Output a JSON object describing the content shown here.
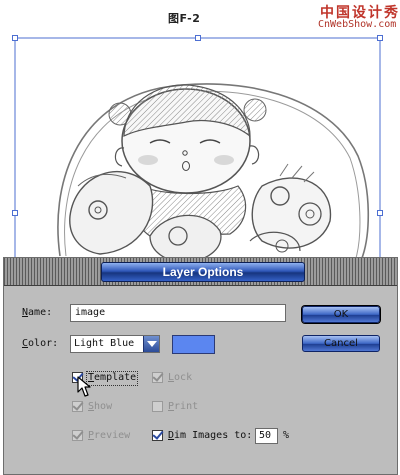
{
  "figure_caption": "图F-2",
  "watermark": {
    "cn": "中国设计秀",
    "en": "CnWebShow.com"
  },
  "dialog": {
    "title": "Layer Options",
    "name_label_first": "N",
    "name_label_rest": "ame:",
    "name_value": "image",
    "color_label_first": "C",
    "color_label_rest": "olor:",
    "color_value": "Light Blue",
    "swatch_color": "#5b86f0",
    "ok_label": "OK",
    "cancel_label": "Cancel",
    "options": {
      "template": {
        "label_first": "T",
        "label_rest": "emplate",
        "checked": true,
        "enabled": true
      },
      "lock": {
        "label_first": "L",
        "label_rest": "ock",
        "checked": true,
        "enabled": false
      },
      "show": {
        "label_first": "S",
        "label_rest": "how",
        "checked": true,
        "enabled": false
      },
      "print": {
        "label_first": "P",
        "label_rest": "rint",
        "checked": false,
        "enabled": false
      },
      "preview": {
        "label_first": "P",
        "label_rest": "review",
        "checked": true,
        "enabled": false
      },
      "dim_images": {
        "label_first": "D",
        "label_rest": "im Images to:",
        "checked": true,
        "enabled": true,
        "value": "50",
        "unit": "%"
      }
    }
  },
  "colors": {
    "title_blue": "#2f57b9",
    "dialog_gray": "#bdbdbd",
    "selection_blue": "#4d6fd2"
  }
}
